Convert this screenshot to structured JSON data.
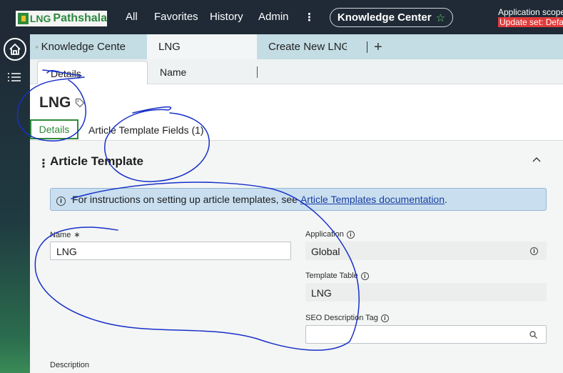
{
  "header": {
    "logo_lng": "LNG",
    "logo_rest": "Pathshala",
    "nav": [
      "All",
      "Favorites",
      "History",
      "Admin"
    ],
    "more": "⋮",
    "knowledge_center": "Knowledge Center",
    "app_scope": "Application scope:",
    "update_set": "Update set: Default"
  },
  "tabs": {
    "t1": "Knowledge Cente",
    "t2": "LNG",
    "t3": "Create New LNG",
    "plus": "+"
  },
  "subtabs": {
    "details": "Details",
    "name": "Name"
  },
  "record": {
    "title": "LNG",
    "details_tab": "Details",
    "fields_tab": "Article Template Fields (1)"
  },
  "section": {
    "title": "Article Template",
    "info_text": "For instructions on setting up article templates, see",
    "info_link": "Article Templates documentation",
    "info_end": "."
  },
  "form": {
    "name_label": "Name",
    "name_required": "∗",
    "name_value": "LNG",
    "app_label": "Application",
    "app_value": "Global",
    "table_label": "Template Table",
    "table_value": "LNG",
    "seo_label": "SEO Description Tag",
    "seo_value": "",
    "desc_label": "Description"
  },
  "colors": {
    "header_bg": "#1f2a36",
    "accent_green": "#2f8a3a",
    "tab_strip": "#c4dde4",
    "update_set_red": "#e23b3b",
    "info_bg": "#c9dff0"
  }
}
